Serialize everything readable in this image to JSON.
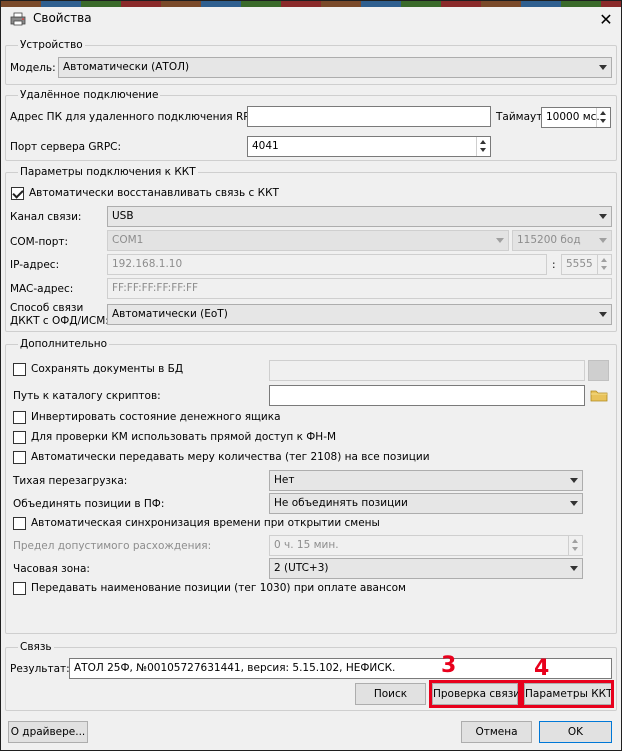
{
  "window": {
    "title": "Свойства",
    "close": "✕"
  },
  "device": {
    "group_title": "Устройство",
    "model_label": "Модель:",
    "model_value": "Автоматически (АТОЛ)"
  },
  "remote": {
    "group_title": "Удалённое подключение",
    "rpc_label": "Адрес ПК для удаленного подключения RPC:",
    "rpc_value": "",
    "timeout_label": "Таймаут",
    "timeout_value": "10000 мс.",
    "grpc_label": "Порт сервера GRPC:",
    "grpc_value": "4041"
  },
  "kkt": {
    "group_title": "Параметры подключения к ККТ",
    "auto_restore_label": "Автоматически восстанавливать связь с ККТ",
    "auto_restore_checked": true,
    "channel_label": "Канал связи:",
    "channel_value": "USB",
    "com_label": "COM-порт:",
    "com_value": "COM1",
    "baud_value": "115200 бод",
    "ip_label": "IP-адрес:",
    "ip_value": "192.168.1.10",
    "colon": ":",
    "port_value": "5555",
    "mac_label": "MAC-адрес:",
    "mac_value": "FF:FF:FF:FF:FF:FF",
    "ofd_label_line1": "Способ связи",
    "ofd_label_line2": "ДККТ с ОФД/ИСМ:",
    "ofd_value": "Автоматически (EoT)"
  },
  "extra": {
    "group_title": "Дополнительно",
    "save_db_label": "Сохранять документы в БД",
    "scripts_label": "Путь к каталогу скриптов:",
    "scripts_value": "",
    "invert_drawer_label": "Инвертировать состояние денежного ящика",
    "km_direct_label": "Для проверки КМ использовать прямой доступ к ФН-М",
    "tag2108_label": "Автоматически передавать меру количества (тег 2108) на все позиции",
    "silent_reboot_label": "Тихая перезагрузка:",
    "silent_reboot_value": "Нет",
    "merge_label": "Объединять позиции в ПФ:",
    "merge_value": "Не объединять позиции",
    "time_sync_label": "Автоматическая синхронизация времени при открытии смены",
    "limit_label": "Предел допустимого расхождения:",
    "limit_value": "0 ч. 15 мин.",
    "tz_label": "Часовая зона:",
    "tz_value": "2 (UTC+3)",
    "tag1030_label": "Передавать наименование позиции (тег 1030) при оплате авансом"
  },
  "link": {
    "group_title": "Связь",
    "result_label": "Результат:",
    "result_value": "АТОЛ 25Ф, №00105727631441, версия: 5.15.102, НЕФИСК.",
    "search_button": "Поиск",
    "check_button": "Проверка связи",
    "params_button": "Параметры ККТ"
  },
  "footer": {
    "about_button": "О драйвере...",
    "cancel_button": "Отмена",
    "ok_button": "OK"
  },
  "annotations": {
    "label_3": "3",
    "label_4": "4",
    "color": "#e8001c"
  }
}
